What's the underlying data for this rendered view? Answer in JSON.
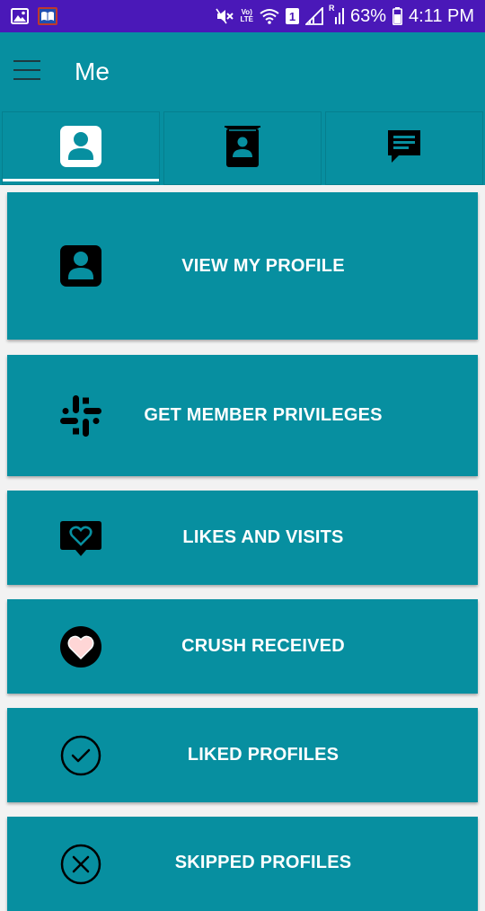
{
  "status_bar": {
    "volte_top": "Vo)",
    "volte_bottom": "LTE",
    "sim_slot": "1",
    "roaming": "R",
    "battery": "63%",
    "time": "4:11 PM"
  },
  "app_bar": {
    "title": "Me"
  },
  "tabs": [
    {
      "icon": "profile-icon",
      "active": true
    },
    {
      "icon": "contacts-book-icon",
      "active": false
    },
    {
      "icon": "chat-message-icon",
      "active": false
    }
  ],
  "cards": [
    {
      "label": "VIEW MY PROFILE",
      "icon": "profile-icon"
    },
    {
      "label": "GET MEMBER PRIVILEGES",
      "icon": "slack-hash-icon"
    },
    {
      "label": "LIKES AND VISITS",
      "icon": "heart-message-icon"
    },
    {
      "label": "CRUSH RECEIVED",
      "icon": "heart-circle-icon"
    },
    {
      "label": "LIKED PROFILES",
      "icon": "check-circle-icon"
    },
    {
      "label": "SKIPPED PROFILES",
      "icon": "x-circle-icon"
    }
  ],
  "colors": {
    "status_bar": "#4a18b8",
    "primary": "#078fa0",
    "background": "#f2f2f2",
    "heart_fill": "#ffd6d6"
  }
}
